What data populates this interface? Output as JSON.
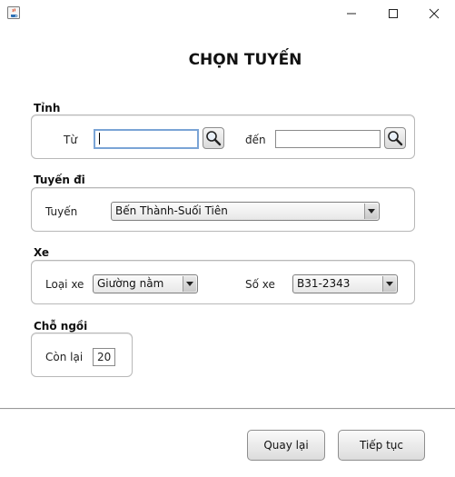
{
  "window": {
    "icon": "java-cup-icon",
    "controls": [
      "minimize-icon",
      "maximize-icon",
      "close-icon"
    ]
  },
  "dialog": {
    "title": "CHỌN TUYẾN"
  },
  "province": {
    "section_label": "Tỉnh",
    "from_label": "Từ",
    "from_value": "",
    "to_label": "đến",
    "to_value": ""
  },
  "route": {
    "section_label": "Tuyến đi",
    "route_label": "Tuyến",
    "route_selected": "Bến Thành-Suối Tiên"
  },
  "vehicle": {
    "section_label": "Xe",
    "type_label": "Loại xe",
    "type_selected": "Giường nằm",
    "number_label": "Số xe",
    "number_selected": "B31-2343"
  },
  "seats": {
    "section_label": "Chỗ ngồi",
    "remaining_label": "Còn lại",
    "remaining_value": "20"
  },
  "footer": {
    "back_label": "Quay lại",
    "next_label": "Tiếp tục"
  }
}
